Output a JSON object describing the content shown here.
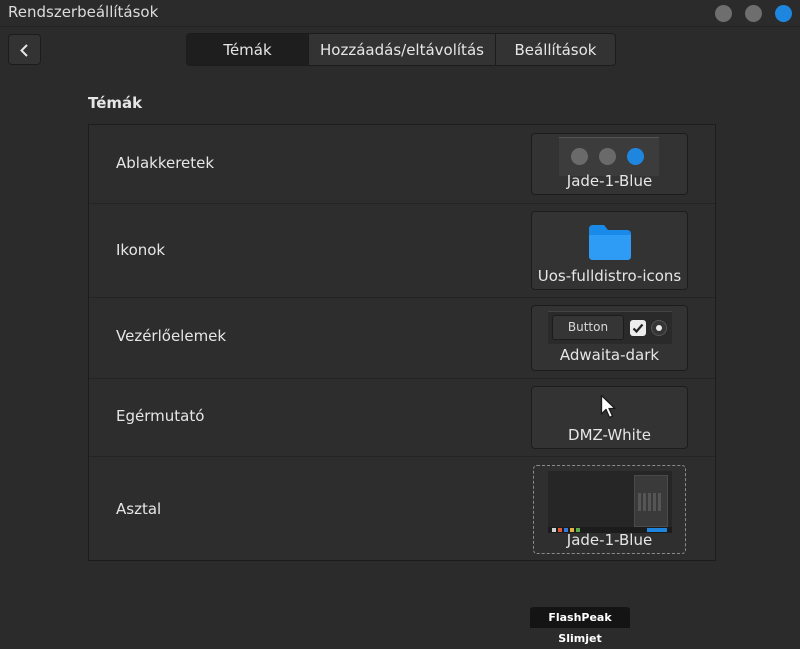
{
  "window": {
    "title": "Rendszerbeállítások",
    "accent_color": "#1f86e0"
  },
  "header": {
    "back_icon": "chevron-left-icon",
    "tabs": [
      {
        "label": "Témák",
        "active": true
      },
      {
        "label": "Hozzáadás/eltávolítás",
        "active": false
      },
      {
        "label": "Beállítások",
        "active": false
      }
    ]
  },
  "section": {
    "title": "Témák"
  },
  "rows": [
    {
      "label": "Ablakkeretek",
      "value": "Jade-1-Blue",
      "preview": "window-buttons-preview"
    },
    {
      "label": "Ikonok",
      "value": "Uos-fulldistro-icons",
      "preview": "folder-icon"
    },
    {
      "label": "Vezérlőelemek",
      "value": "Adwaita-dark",
      "preview": "widgets-preview",
      "preview_button_label": "Button"
    },
    {
      "label": "Egérmutató",
      "value": "DMZ-White",
      "preview": "cursor-icon"
    },
    {
      "label": "Asztal",
      "value": "Jade-1-Blue",
      "preview": "desktop-preview"
    }
  ],
  "tooltip": {
    "text": "FlashPeak Slimjet"
  }
}
